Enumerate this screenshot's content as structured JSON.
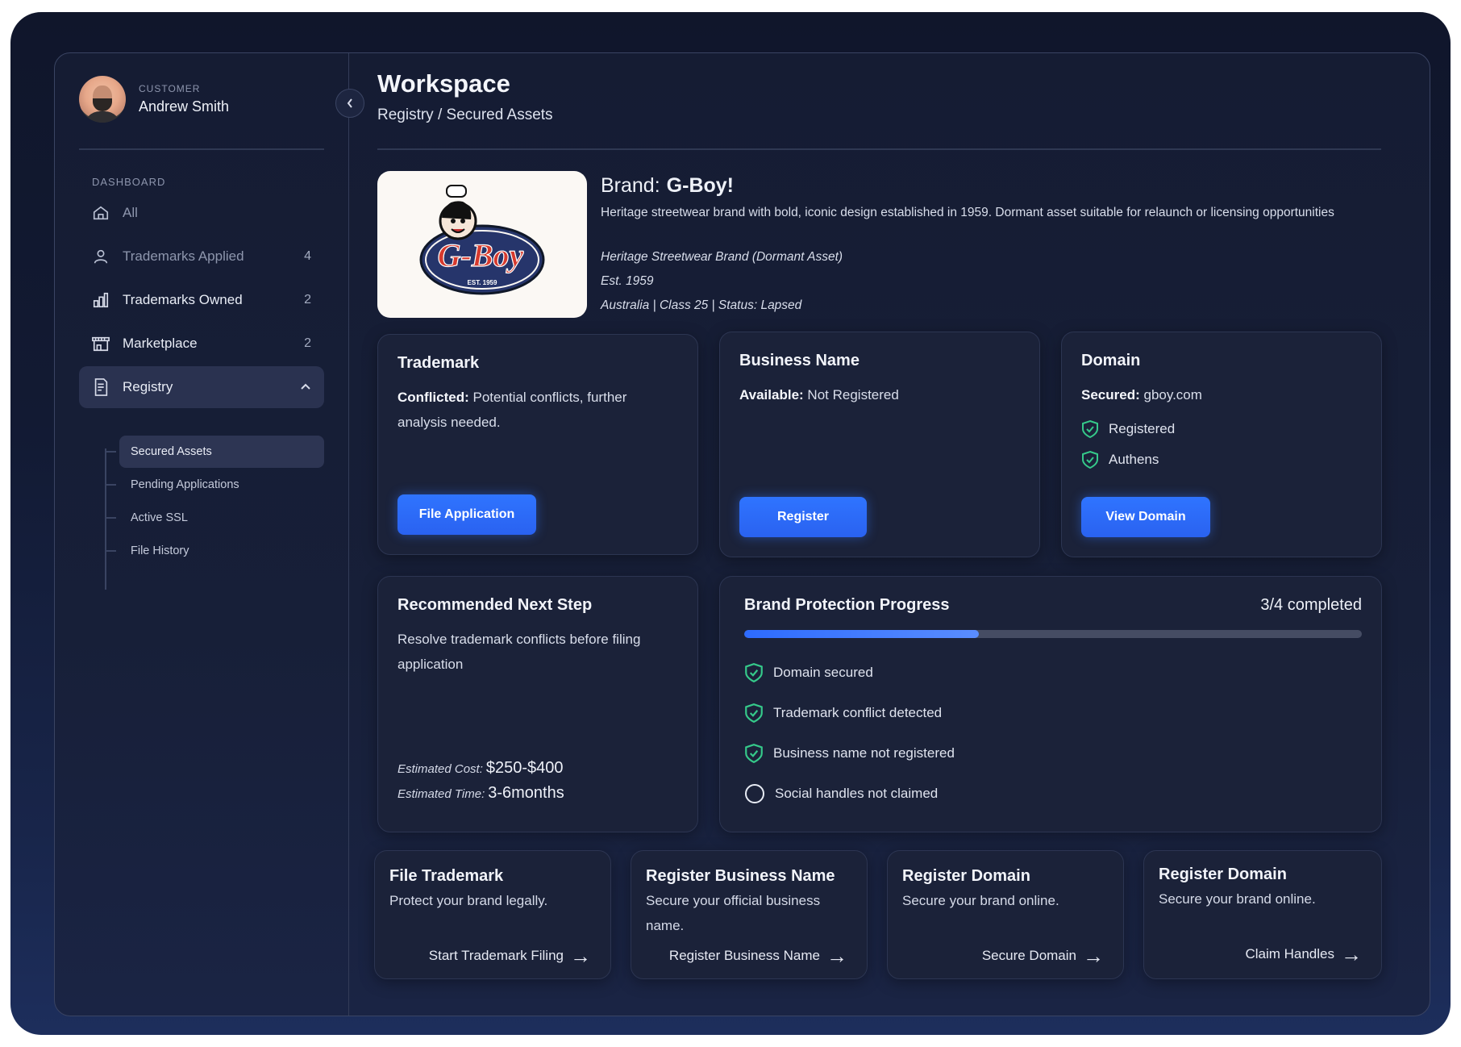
{
  "user": {
    "role": "CUSTOMER",
    "name": "Andrew Smith"
  },
  "sidebar": {
    "section_label": "DASHBOARD",
    "items": [
      {
        "label": "All",
        "count": ""
      },
      {
        "label": "Trademarks Applied",
        "count": "4"
      },
      {
        "label": "Trademarks Owned",
        "count": "2"
      },
      {
        "label": "Marketplace",
        "count": "2"
      },
      {
        "label": "Registry",
        "count": ""
      }
    ],
    "registry_children": [
      "Secured Assets",
      "Pending Applications",
      "Active SSL",
      "File History"
    ]
  },
  "header": {
    "title": "Workspace",
    "breadcrumb": "Registry / Secured Assets"
  },
  "brand": {
    "label": "Brand:",
    "name": "G-Boy!",
    "description": "Heritage streetwear brand with bold, iconic design established in 1959. Dormant asset suitable for relaunch or licensing opportunities",
    "subtitle": "Heritage Streetwear Brand (Dormant Asset)",
    "established": "Est. 1959",
    "details": "Australia | Class 25 | Status: Lapsed",
    "logo_text": "G-Boy",
    "logo_est": "EST. 1959"
  },
  "cards": {
    "trademark": {
      "title": "Trademark",
      "status_label": "Conflicted:",
      "status_text": "Potential conflicts, further analysis needed.",
      "button": "File Application"
    },
    "business": {
      "title": "Business Name",
      "status_label": "Available:",
      "status_text": "Not Registered",
      "button": "Register"
    },
    "domain": {
      "title": "Domain",
      "status_label": "Secured:",
      "status_text": "gboy.com",
      "checks": [
        "Registered",
        "Authens"
      ],
      "button": "View Domain"
    }
  },
  "next_step": {
    "title": "Recommended Next Step",
    "text": "Resolve trademark conflicts before filing application",
    "cost_label": "Estimated Cost:",
    "cost_value": "$250-$400",
    "time_label": "Estimated Time:",
    "time_value": "3-6months"
  },
  "progress": {
    "title": "Brand Protection Progress",
    "summary": "3/4 completed",
    "fraction": 0.38,
    "items": [
      {
        "label": "Domain secured",
        "done": true
      },
      {
        "label": "Trademark conflict detected",
        "done": true
      },
      {
        "label": "Business name not registered",
        "done": true
      },
      {
        "label": "Social handles not claimed",
        "done": false
      }
    ]
  },
  "actions": [
    {
      "title": "File Trademark",
      "desc": "Protect your brand legally.",
      "link": "Start Trademark Filing"
    },
    {
      "title": "Register Business Name",
      "desc": "Secure your official business name.",
      "link": "Register Business Name"
    },
    {
      "title": "Register Domain",
      "desc": "Secure your brand online.",
      "link": "Secure Domain"
    },
    {
      "title": "Register Domain",
      "desc": "Secure your brand online.",
      "link": "Claim Handles"
    }
  ],
  "colors": {
    "accent": "#2f6fff",
    "check": "#35c98a",
    "background": "#151c33"
  }
}
